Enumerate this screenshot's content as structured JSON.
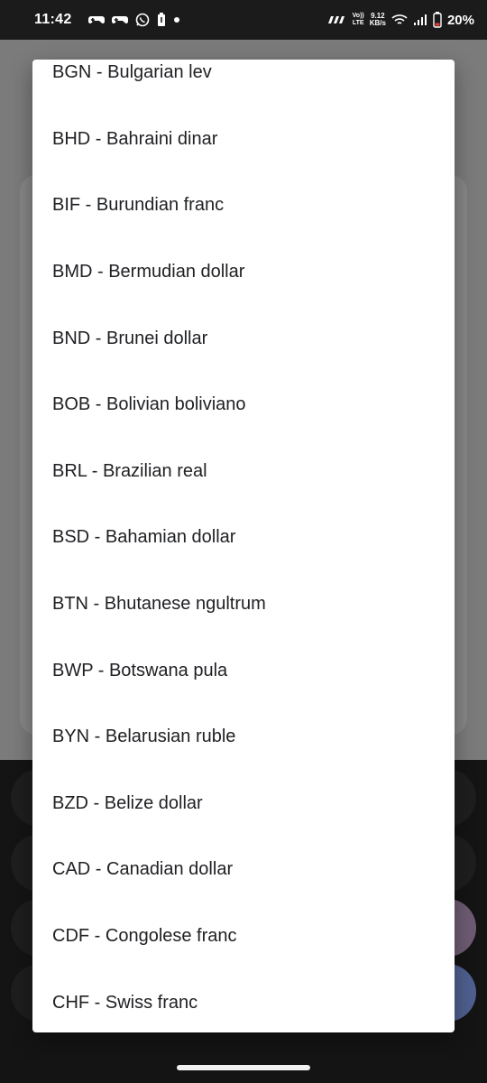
{
  "status_bar": {
    "time": "11:42",
    "net_top": "9.12",
    "net_bottom": "KB/s",
    "carrier_badge": "Vo)) LTE",
    "battery": "20%"
  },
  "dialog": {
    "items": [
      {
        "label": "BGN - Bulgarian lev"
      },
      {
        "label": "BHD - Bahraini dinar"
      },
      {
        "label": "BIF - Burundian franc"
      },
      {
        "label": "BMD - Bermudian dollar"
      },
      {
        "label": "BND - Brunei dollar"
      },
      {
        "label": "BOB - Bolivian boliviano"
      },
      {
        "label": "BRL - Brazilian real"
      },
      {
        "label": "BSD - Bahamian dollar"
      },
      {
        "label": "BTN - Bhutanese ngultrum"
      },
      {
        "label": "BWP - Botswana pula"
      },
      {
        "label": "BYN - Belarusian ruble"
      },
      {
        "label": "BZD - Belize dollar"
      },
      {
        "label": "CAD - Canadian dollar"
      },
      {
        "label": "CDF - Congolese franc"
      },
      {
        "label": "CHF - Swiss franc"
      }
    ]
  }
}
